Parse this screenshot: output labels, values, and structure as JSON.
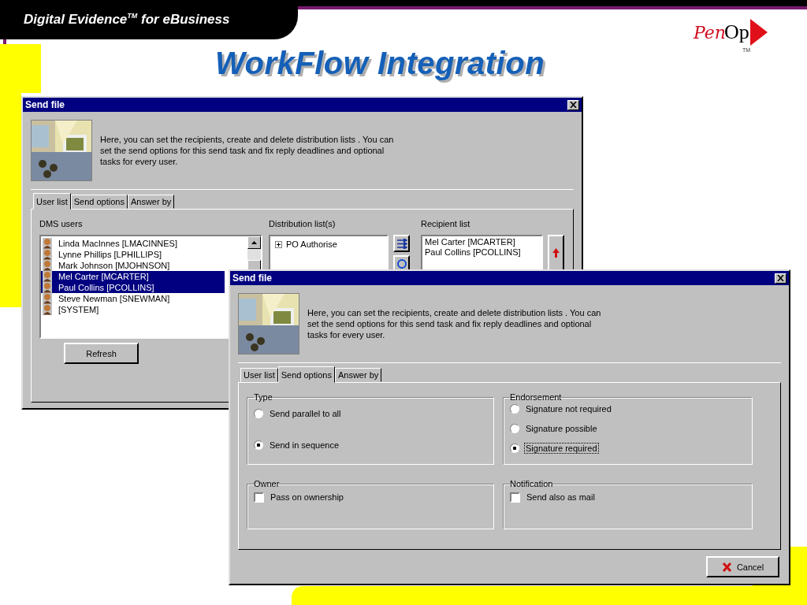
{
  "slide": {
    "header": "Digital Evidence$^{TM}$ for eBusiness",
    "logo": {
      "script": "Pen",
      "text": "Op",
      "mark": "TM"
    },
    "title": "WorkFlow Integration"
  },
  "back_dialog": {
    "title": "Send file",
    "intro": "Here, you can set the recipients, create and delete distribution lists . You can set the send options for this send task and fix reply deadlines and optional tasks for every user.",
    "tabs": [
      {
        "label": "User list",
        "selected": true
      },
      {
        "label": "Send options",
        "selected": false
      },
      {
        "label": "Answer by",
        "selected": false
      }
    ],
    "dms_users": {
      "label": "DMS users",
      "items": [
        {
          "name": "Linda MacInnes [LMACINNES]",
          "selected": false
        },
        {
          "name": "Lynne Phillips [LPHILLIPS]",
          "selected": false
        },
        {
          "name": "Mark Johnson [MJOHNSON]",
          "selected": false
        },
        {
          "name": "Mel Carter [MCARTER]",
          "selected": true
        },
        {
          "name": "Paul Collins [PCOLLINS]",
          "selected": true
        },
        {
          "name": "Steve Newman [SNEWMAN]",
          "selected": false
        },
        {
          "name": "[SYSTEM]",
          "selected": false
        }
      ]
    },
    "refresh_button": "Refresh",
    "distribution_lists": {
      "label": "Distribution list(s)",
      "items": [
        {
          "label": "PO Authorise",
          "expanded": false
        }
      ]
    },
    "recipient_list": {
      "label": "Recipient list",
      "items": [
        "Mel Carter [MCARTER]",
        "Paul Collins [PCOLLINS]"
      ]
    }
  },
  "front_dialog": {
    "title": "Send file",
    "intro": "Here, you can set the recipients, create and delete distribution lists . You can set the send options for this send task and fix reply deadlines and optional tasks for every user.",
    "tabs": [
      {
        "label": "User list",
        "selected": false
      },
      {
        "label": "Send options",
        "selected": true
      },
      {
        "label": "Answer by",
        "selected": false
      }
    ],
    "groups": [
      {
        "title": "Type",
        "kind": "radio",
        "options": [
          {
            "label": "Send parallel to all",
            "selected": false,
            "focused": false
          },
          {
            "label": "Send in sequence",
            "selected": true,
            "focused": false
          }
        ]
      },
      {
        "title": "Endorsement",
        "kind": "radio",
        "options": [
          {
            "label": "Signature not required",
            "selected": false,
            "focused": false
          },
          {
            "label": "Signature possible",
            "selected": false,
            "focused": false
          },
          {
            "label": "Signature required",
            "selected": true,
            "focused": true
          }
        ]
      },
      {
        "title": "Owner",
        "kind": "checkbox",
        "options": [
          {
            "label": "Pass on ownership",
            "checked": false
          }
        ]
      },
      {
        "title": "Notification",
        "kind": "checkbox",
        "options": [
          {
            "label": "Send also as mail",
            "checked": false
          }
        ]
      }
    ],
    "cancel_button": "Cancel"
  }
}
